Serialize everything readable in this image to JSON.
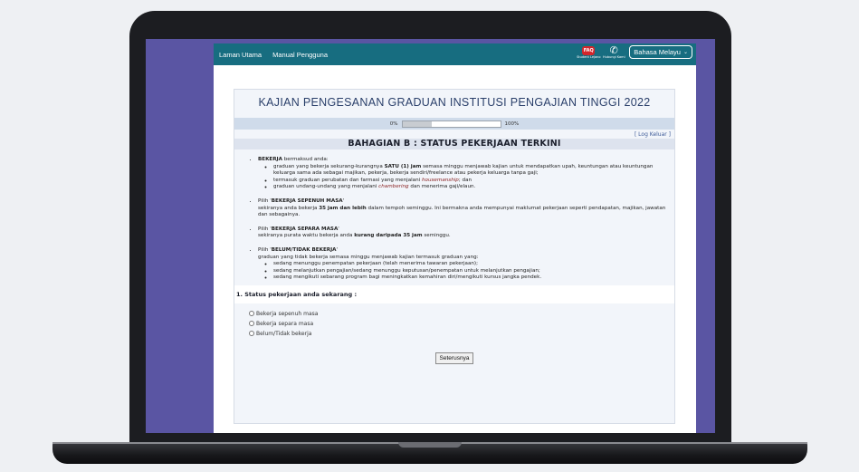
{
  "nav": {
    "links": [
      "Laman Utama",
      "Manual Pengguna"
    ],
    "faq_badge": "FAQ",
    "faq_caption": "Student Lejano",
    "phone_caption": "Hubungi Kami",
    "language": "Bahasa Melayu"
  },
  "survey": {
    "title": "KAJIAN PENGESANAN GRADUAN INSTITUSI PENGAJIAN TINGGI 2022",
    "progress": {
      "left_label": "0%",
      "right_label": "100%",
      "value": 0.3
    },
    "logout": "[ Log Keluar ]",
    "section_title": "BAHAGIAN B : STATUS PEKERJAAN TERKINI",
    "bekerja": {
      "term": "BEKERJA",
      "intro": " bermaksud anda:",
      "b1_pre": "graduan yang bekerja sekurang-kurangnya ",
      "b1_bold": "SATU (1) jam",
      "b1_post": " semasa minggu menjawab kajian untuk mendapatkan upah, keuntungan atau keuntungan keluarga sama ada sebagai majikan, pekerja, bekerja sendiri/freelance atau pekerja keluarga tanpa gaji;",
      "b2_pre": "termasuk graduan perubatan dan farmasi yang menjalani ",
      "b2_em": "housemanship",
      "b2_post": "; dan",
      "b3_pre": "graduan undang-undang yang menjalani ",
      "b3_em": "chambering",
      "b3_post": " dan menerima gaji/elaun."
    },
    "sepenuh": {
      "pre": "Pilih '",
      "term": "BEKERJA SEPENUH MASA",
      "post": "'",
      "l2_pre": "sekiranya anda bekerja ",
      "l2_bold": "35 jam dan lebih",
      "l2_post": " dalam tempoh seminggu. Ini bermakna anda mempunyai maklumat pekerjaan seperti pendapatan, majikan, jawatan dan sebagainya."
    },
    "separa": {
      "pre": "Pilih '",
      "term": "BEKERJA SEPARA MASA",
      "post": "'",
      "l2_pre": "sekiranya purata waktu bekerja anda ",
      "l2_bold": "kurang daripada 35 jam",
      "l2_post": " seminggu."
    },
    "belum": {
      "pre": "Pilih '",
      "term": "BELUM/TIDAK BEKERJA",
      "post": "'",
      "l2": "graduan yang tidak bekerja semasa minggu menjawab kajian termasuk graduan yang:",
      "items": [
        "sedang menunggu penempatan pekerjaan (telah menerima tawaran pekerjaan);",
        "sedang melanjutkan pengajian/sedang menunggu keputusan/penempatan untuk melanjutkan pengajian;",
        "sedang mengikuti sebarang program bagi meningkatkan kemahiran diri/mengikuti kursus jangka pendek."
      ]
    },
    "question": "1. Status pekerjaan anda sekarang :",
    "options": [
      "Bekerja sepenuh masa",
      "Bekerja separa masa",
      "Belum/Tidak bekerja"
    ],
    "next_button": "Seterusnya"
  }
}
